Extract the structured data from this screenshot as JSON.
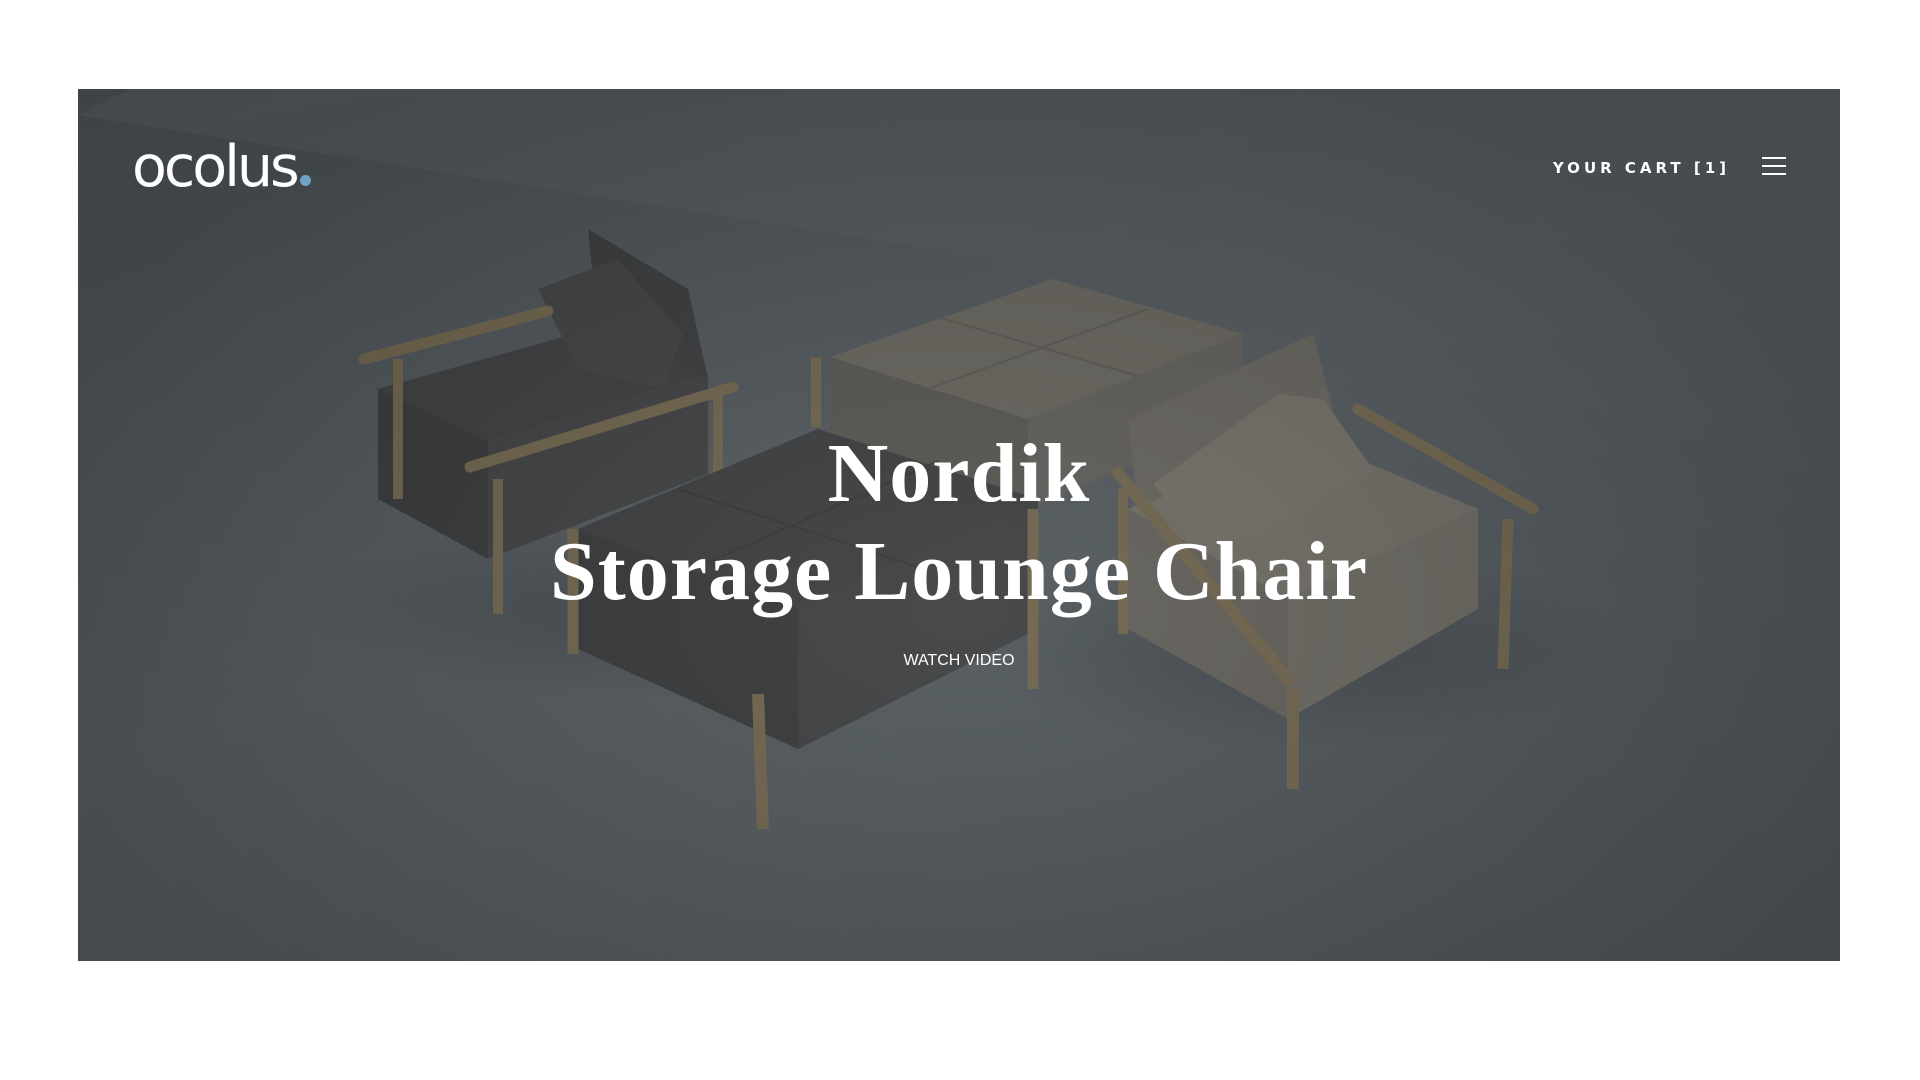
{
  "brand": {
    "name": "ocolus",
    "accent_color": "#6fa3c6"
  },
  "header": {
    "cart_label": "YOUR CART [1]",
    "menu_icon": "hamburger-menu-icon"
  },
  "hero": {
    "title_line1": "Nordik",
    "title_line2": "Storage Lounge Chair",
    "cta_label": "WATCH VIDEO"
  },
  "colors": {
    "page_background": "#ffffff",
    "hero_overlay": "#50565a",
    "text": "#ffffff"
  }
}
